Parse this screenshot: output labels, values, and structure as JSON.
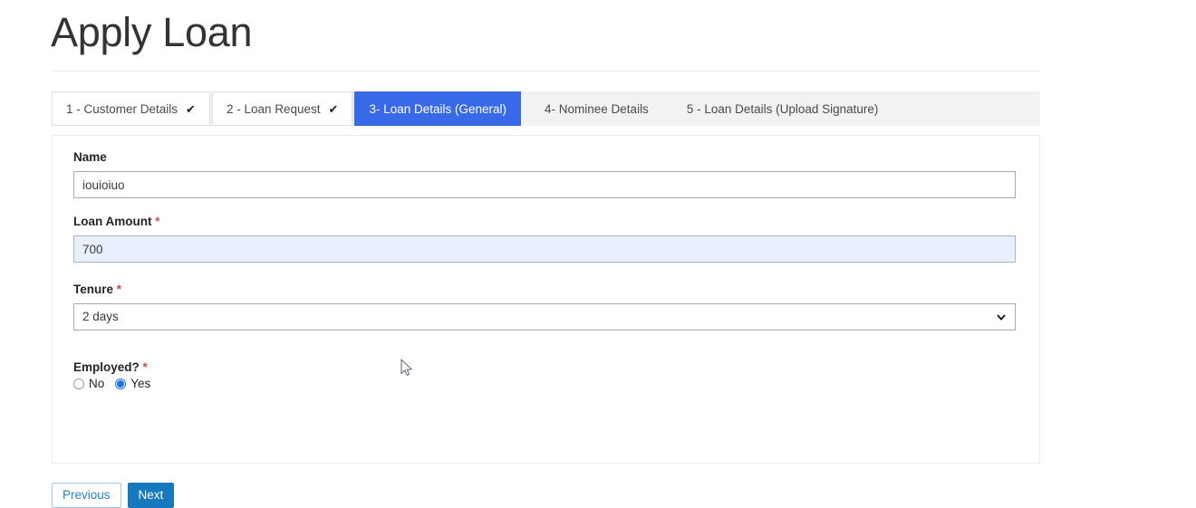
{
  "header": {
    "title": "Apply Loan"
  },
  "wizard": {
    "steps": [
      {
        "label": "1 - Customer Details",
        "state": "done",
        "check": "✔"
      },
      {
        "label": "2 - Loan Request",
        "state": "done",
        "check": "✔"
      },
      {
        "label": "3- Loan Details (General)",
        "state": "active"
      },
      {
        "label": "4- Nominee Details",
        "state": "plain"
      },
      {
        "label": "5 - Loan Details (Upload Signature)",
        "state": "plain"
      }
    ],
    "active_index": 2,
    "active_color": "#3869e8"
  },
  "form": {
    "name": {
      "label": "Name",
      "value": "iouioiuo",
      "placeholder": ""
    },
    "loan_amount": {
      "label": "Loan Amount",
      "required_mark": "*",
      "value": "700",
      "placeholder": "",
      "autofill_color": "#e8f0fe"
    },
    "tenure": {
      "label": "Tenure",
      "required_mark": "*",
      "value": "2 days",
      "options": [
        "2 days"
      ],
      "chevron_icon": "chevron-down-icon"
    },
    "employed": {
      "label": "Employed?",
      "required_mark": "*",
      "options": [
        {
          "label": "No",
          "selected": false
        },
        {
          "label": "Yes",
          "selected": true
        }
      ],
      "selected_color": "#1a73e8"
    }
  },
  "footer": {
    "previous_label": "Previous",
    "next_label": "Next",
    "next_color": "#1679bd",
    "previous_text_color": "#2a7fc9"
  }
}
